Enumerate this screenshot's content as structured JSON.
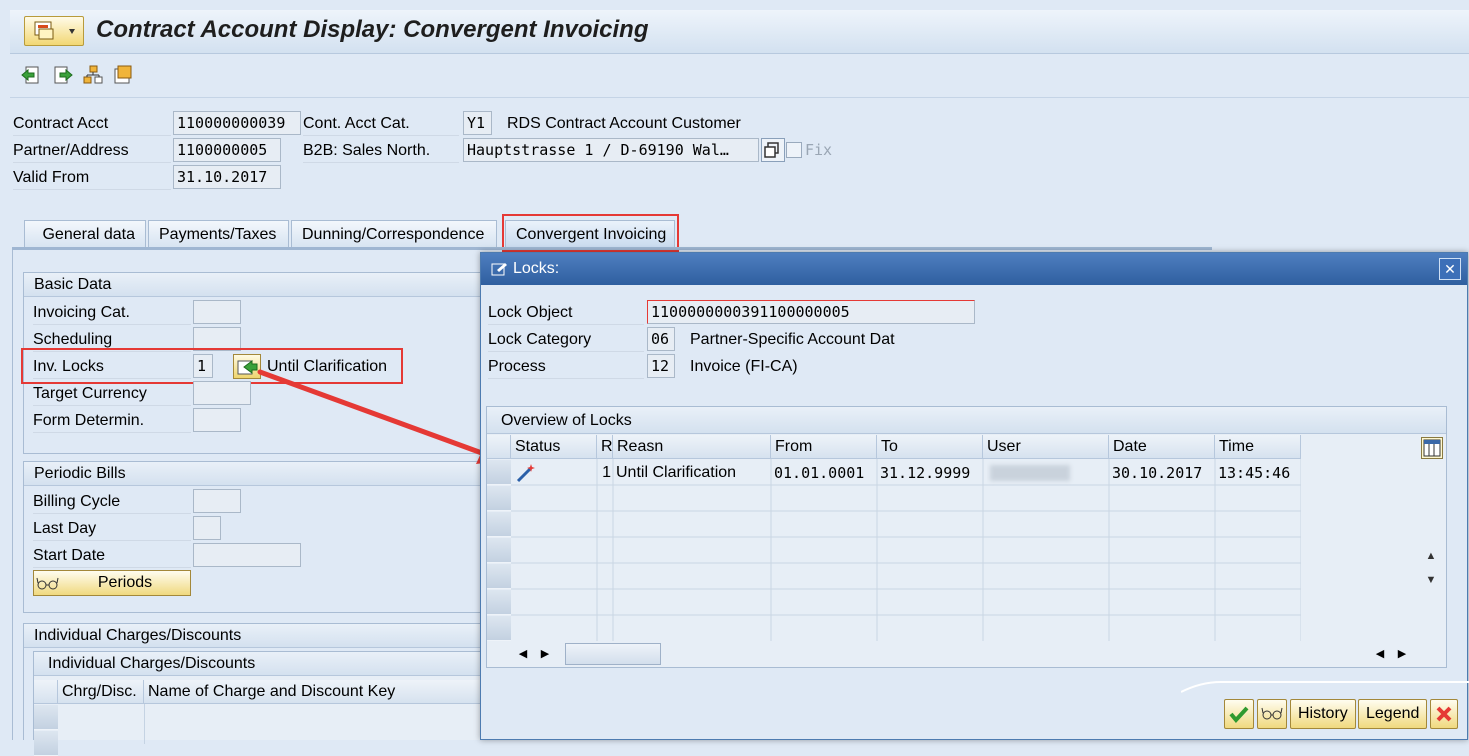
{
  "window": {
    "title": "Contract Account Display: Convergent Invoicing"
  },
  "header": {
    "contract_acct_label": "Contract Acct",
    "contract_acct_value": "110000000039",
    "cont_acct_cat_label": "Cont. Acct Cat.",
    "cont_acct_cat_value": "Y1",
    "cont_acct_cat_text": "RDS Contract Account Customer",
    "partner_label": "Partner/Address",
    "partner_value": "1100000005",
    "b2b_label": "B2B: Sales North.",
    "address_value": "Hauptstrasse 1 / D-69190 Wal…",
    "fix_label": "Fix",
    "valid_from_label": "Valid From",
    "valid_from_value": "31.10.2017"
  },
  "tabs": [
    {
      "label": "General data"
    },
    {
      "label": "Payments/Taxes"
    },
    {
      "label": "Dunning/Correspondence"
    },
    {
      "label": "Convergent Invoicing"
    }
  ],
  "basic_data": {
    "heading": "Basic Data",
    "invoicing_cat_label": "Invoicing Cat.",
    "scheduling_label": "Scheduling",
    "inv_locks_label": "Inv. Locks",
    "inv_locks_value": "1",
    "inv_locks_text": "Until Clarification",
    "target_currency_label": "Target Currency",
    "form_determin_label": "Form Determin."
  },
  "periodic_bills": {
    "heading": "Periodic Bills",
    "billing_cycle_label": "Billing Cycle",
    "last_day_label": "Last Day",
    "start_date_label": "Start Date",
    "periods_button": "Periods"
  },
  "charges": {
    "heading": "Individual Charges/Discounts",
    "subheading": "Individual Charges/Discounts",
    "col_chrg": "Chrg/Disc.",
    "col_name": "Name of Charge and Discount Key"
  },
  "dialog": {
    "title": "Locks:",
    "lock_object_label": "Lock Object",
    "lock_object_value": "1100000000391100000005",
    "lock_category_label": "Lock Category",
    "lock_category_value": "06",
    "lock_category_text": "Partner-Specific Account Dat",
    "process_label": "Process",
    "process_value": "12",
    "process_text": "Invoice (FI-CA)",
    "overview_heading": "Overview of Locks",
    "columns": {
      "status": "Status",
      "r": "R",
      "reasn": "Reasn",
      "from": "From",
      "to": "To",
      "user": "User",
      "date": "Date",
      "time": "Time"
    },
    "rows": [
      {
        "r": "1",
        "reasn": "Until Clarification",
        "from": "01.01.0001",
        "to": "31.12.9999",
        "date": "30.10.2017",
        "time": "13:45:46"
      }
    ],
    "buttons": {
      "history": "History",
      "legend": "Legend"
    }
  },
  "colors": {
    "accent_red": "#e53935",
    "dialog_title": "#3a68a8",
    "button_yellow": "#f0d97f"
  }
}
